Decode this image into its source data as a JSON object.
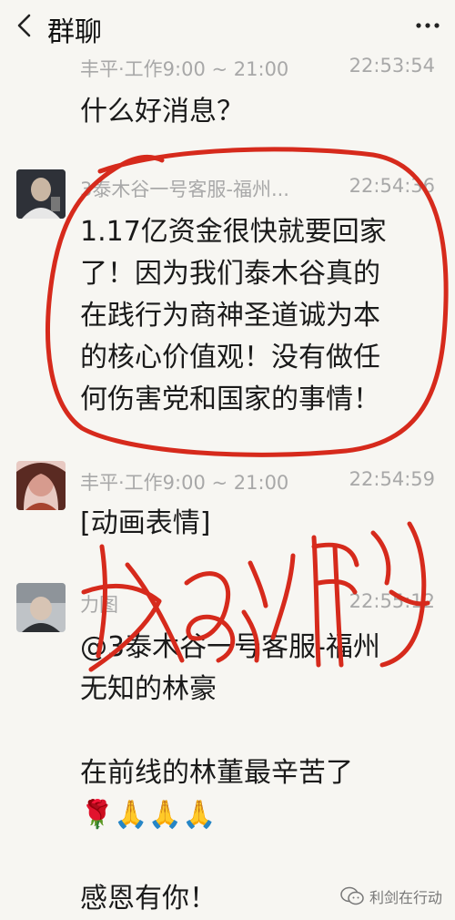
{
  "header": {
    "title": "群聊",
    "back_icon": "chevron-left-icon",
    "more_icon": "more-dots-icon"
  },
  "messages": [
    {
      "sender": "丰平·工作9:00 ~ 21:00",
      "time": "22:53:54",
      "lines": [
        "什么好消息？"
      ]
    },
    {
      "sender": "3泰木谷一号客服-福州...",
      "time": "22:54:36",
      "lines": [
        "1.17亿资金很快就要回家",
        "了！因为我们泰木谷真的",
        "在践行为商神圣道诚为本",
        "的核心价值观！没有做任",
        "何伤害党和国家的事情！"
      ]
    },
    {
      "sender": "丰平·工作9:00 ~ 21:00",
      "time": "22:54:59",
      "lines": [
        "[动画表情]"
      ]
    },
    {
      "sender": "力图",
      "time": "22:55:12",
      "lines": [
        "@3泰木谷一号客服-福州",
        "无知的林豪",
        "",
        "在前线的林董最辛苦了",
        "🌹🙏🙏🙏",
        "",
        "感恩有你！"
      ]
    }
  ],
  "watermark": {
    "text": "利剑在行动",
    "icon": "wechat-icon"
  },
  "annotation": {
    "handwriting": "好消息",
    "color": "#d62a1c"
  }
}
